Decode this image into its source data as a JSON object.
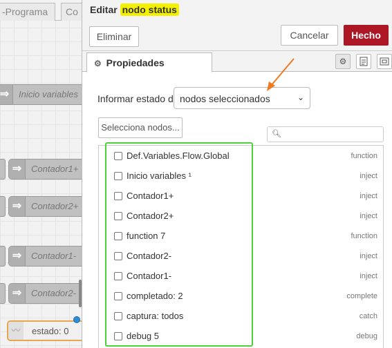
{
  "workspace": {
    "tabs": [
      "-Programa",
      "Co"
    ],
    "nodes": [
      "Inicio variables",
      "Contador1+",
      "Contador2+",
      "Contador1-",
      "Contador2-"
    ],
    "status_node_label": "estado: 0"
  },
  "tray": {
    "title_prefix": "Editar",
    "title_highlight": "nodo status",
    "delete_label": "Eliminar",
    "cancel_label": "Cancelar",
    "done_label": "Hecho",
    "tab_properties": "Propiedades",
    "tab_icons": [
      "gear-icon",
      "description-icon",
      "appearance-icon"
    ],
    "report_label": "Informar estado de",
    "report_value": "nodos seleccionados",
    "select_nodes_label": "Selecciona nodos...",
    "search_placeholder": ""
  },
  "node_list": [
    {
      "name": "Def.Variables.Flow.Global",
      "type": "function"
    },
    {
      "name": "Inicio variables ¹",
      "type": "inject"
    },
    {
      "name": "Contador1+",
      "type": "inject"
    },
    {
      "name": "Contador2+",
      "type": "inject"
    },
    {
      "name": "function 7",
      "type": "function"
    },
    {
      "name": "Contador2-",
      "type": "inject"
    },
    {
      "name": "Contador1-",
      "type": "inject"
    },
    {
      "name": "completado: 2",
      "type": "complete"
    },
    {
      "name": "captura: todos",
      "type": "catch"
    },
    {
      "name": "debug 5",
      "type": "debug"
    }
  ],
  "colors": {
    "done_button": "#ad1625",
    "highlight": "#f5f000",
    "annotation_arrow": "#f07a22",
    "annotation_box": "#4fcf3c"
  }
}
